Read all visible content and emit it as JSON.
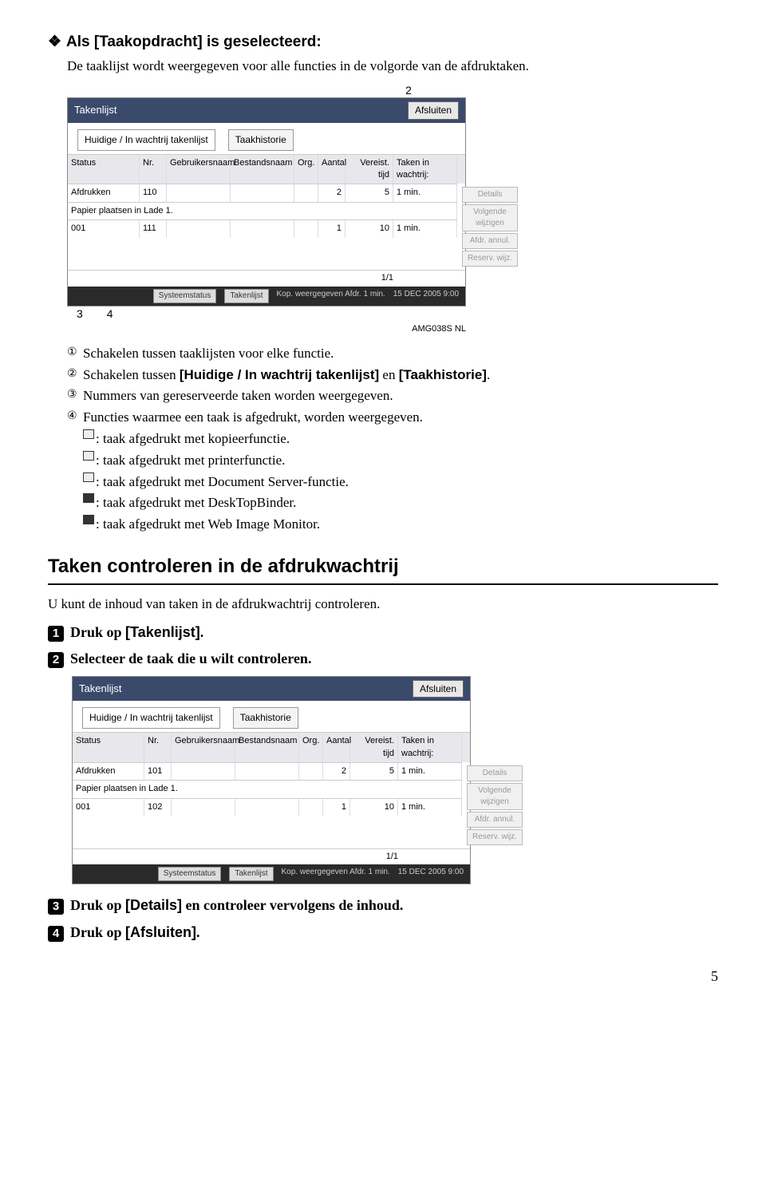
{
  "section": {
    "title_prefix": "Als ",
    "title_bold": "[Taakopdracht]",
    "title_suffix": " is geselecteerd:",
    "description": "De taaklijst wordt weergegeven voor alle functies in de volgorde van de afdruktaken."
  },
  "callout_top": "2",
  "callout_bottom_a": "3",
  "callout_bottom_b": "4",
  "fig_label": "AMG038S NL",
  "screenshot1": {
    "title": "Takenlijst",
    "close": "Afsluiten",
    "tab1": "Huidige / In wachtrij takenlijst",
    "tab2": "Taakhistorie",
    "cols": {
      "status": "Status",
      "nr": "Nr.",
      "user": "Gebruikersnaam",
      "best": "Bestandsnaam",
      "org": "Org.",
      "aant": "Aantal",
      "ver": "Vereist. tijd",
      "wacht": "Taken in wachtrij:"
    },
    "rows": [
      {
        "status": "Afdrukken",
        "nr": "110",
        "user": "",
        "best": "",
        "org": "",
        "aant": "2",
        "ver": "5",
        "unit": "1 min."
      },
      {
        "status": "Papier plaatsen in Lade 1.",
        "nr": "",
        "user": "",
        "best": "",
        "org": "",
        "aant": "",
        "ver": "",
        "unit": ""
      },
      {
        "status": "001",
        "nr": "111",
        "user": "",
        "best": "",
        "org": "",
        "aant": "1",
        "ver": "10",
        "unit": "1 min."
      }
    ],
    "btns": [
      "Details",
      "Volgende wijzigen",
      "Afdr. annul.",
      "Reserv. wijz."
    ],
    "pager": "1/1",
    "status_a": "Systeemstatus",
    "status_b": "Takenlijst",
    "status_c": "Kop. weergegeven\nAfdr. 1 min.",
    "status_d": "15 DEC 2005\n9:00"
  },
  "list": {
    "n1": "①",
    "t1": "Schakelen tussen taaklijsten voor elke functie.",
    "n2": "②",
    "t2a": "Schakelen tussen ",
    "t2b": "[Huidige / In wachtrij takenlijst]",
    "t2c": " en ",
    "t2d": "[Taakhistorie]",
    "t2e": ".",
    "n3": "③",
    "t3": "Nummers van gereserveerde taken worden weergegeven.",
    "n4": "④",
    "t4": "Functies waarmee een taak is afgedrukt, worden weergegeven.",
    "i1": ": taak afgedrukt met kopieerfunctie.",
    "i2": ": taak afgedrukt met printerfunctie.",
    "i3": ": taak afgedrukt met Document Server-functie.",
    "i4": ": taak afgedrukt met DeskTopBinder.",
    "i5": ": taak afgedrukt met Web Image Monitor."
  },
  "heading2": "Taken controleren in de afdrukwachtrij",
  "para2": "U kunt de inhoud van taken in de afdrukwachtrij controleren.",
  "steps": {
    "s1n": "1",
    "s1a": "Druk op ",
    "s1b": "[Takenlijst]",
    "s1c": ".",
    "s2n": "2",
    "s2": "Selecteer de taak die u wilt controleren.",
    "s3n": "3",
    "s3a": "Druk op ",
    "s3b": "[Details]",
    "s3c": " en controleer vervolgens de inhoud.",
    "s4n": "4",
    "s4a": "Druk op ",
    "s4b": "[Afsluiten]",
    "s4c": "."
  },
  "screenshot2": {
    "title": "Takenlijst",
    "close": "Afsluiten",
    "tab1": "Huidige / In wachtrij takenlijst",
    "tab2": "Taakhistorie",
    "rows": [
      {
        "status": "Afdrukken",
        "nr": "101",
        "aant": "2",
        "ver": "5",
        "unit": "1 min."
      },
      {
        "status": "Papier plaatsen in Lade 1.",
        "nr": "",
        "aant": "",
        "ver": "",
        "unit": ""
      },
      {
        "status": "001",
        "nr": "102",
        "aant": "1",
        "ver": "10",
        "unit": "1 min."
      }
    ],
    "pager": "1/1"
  },
  "pagenum": "5"
}
